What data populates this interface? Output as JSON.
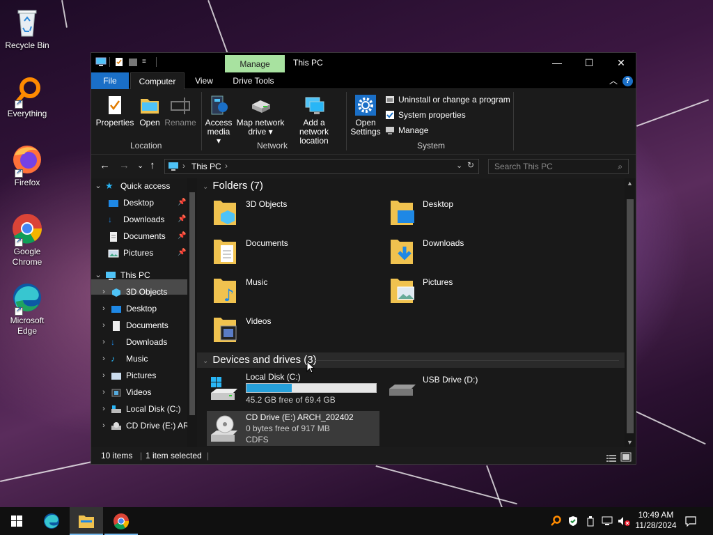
{
  "desktop": {
    "icons": [
      {
        "label": "Recycle Bin"
      },
      {
        "label": "Everything"
      },
      {
        "label": "Firefox"
      },
      {
        "label": "Google Chrome"
      },
      {
        "label": "Microsoft Edge"
      }
    ]
  },
  "window": {
    "title": "This PC",
    "manage_tab": "Manage",
    "tabs": {
      "file": "File",
      "computer": "Computer",
      "view": "View",
      "drive_tools": "Drive Tools"
    },
    "ribbon": {
      "location": {
        "label": "Location",
        "properties": "Properties",
        "open": "Open",
        "rename": "Rename"
      },
      "network": {
        "label": "Network",
        "access_media": "Access\nmedia ▾",
        "access_media_1": "Access",
        "access_media_2": "media ▾",
        "map_drive_1": "Map network",
        "map_drive_2": "drive ▾",
        "add_location_1": "Add a network",
        "add_location_2": "location"
      },
      "system": {
        "label": "System",
        "open_settings_1": "Open",
        "open_settings_2": "Settings",
        "uninstall": "Uninstall or change a program",
        "system_properties": "System properties",
        "manage": "Manage"
      }
    },
    "address": {
      "crumb": "This PC",
      "search_placeholder": "Search This PC"
    },
    "nav": {
      "quick_access": "Quick access",
      "qa_items": [
        "Desktop",
        "Downloads",
        "Documents",
        "Pictures"
      ],
      "this_pc": "This PC",
      "pc_items": [
        "3D Objects",
        "Desktop",
        "Documents",
        "Downloads",
        "Music",
        "Pictures",
        "Videos",
        "Local Disk (C:)",
        "CD Drive (E:) AR("
      ]
    },
    "content": {
      "folders_header": "Folders (7)",
      "folders": [
        "3D Objects",
        "Desktop",
        "Documents",
        "Downloads",
        "Music",
        "Pictures",
        "Videos"
      ],
      "devices_header": "Devices and drives (3)",
      "drives": [
        {
          "name": "Local Disk (C:)",
          "free": "45.2 GB free of 69.4 GB",
          "used_fraction": 0.35
        },
        {
          "name": "USB Drive (D:)"
        },
        {
          "name": "CD Drive (E:) ARCH_202402",
          "free": "0 bytes free of 917 MB",
          "fs": "CDFS"
        }
      ]
    },
    "status": {
      "items": "10 items",
      "selected": "1 item selected"
    }
  },
  "taskbar": {
    "time": "10:49 AM",
    "date": "11/28/2024"
  },
  "colors": {
    "accent": "#1a6fc7",
    "manage_tab": "#a8e2a0",
    "drive_bar": "#26a0da"
  }
}
